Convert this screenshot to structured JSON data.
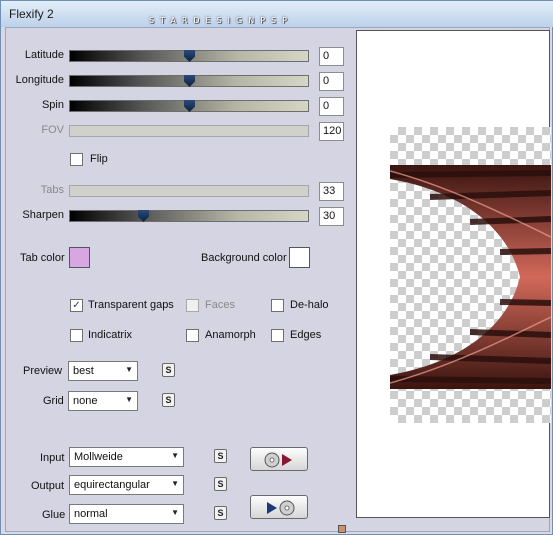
{
  "window": {
    "title": "Flexify 2",
    "brand": "STARDESIGNPSP"
  },
  "sliders": [
    {
      "label": "Latitude",
      "value": "0",
      "level": 0.5,
      "disabled": false
    },
    {
      "label": "Longitude",
      "value": "0",
      "level": 0.5,
      "disabled": false
    },
    {
      "label": "Spin",
      "value": "0",
      "level": 0.5,
      "disabled": false
    },
    {
      "label": "FOV",
      "value": "120",
      "level": null,
      "disabled": true
    },
    {
      "label": "Tabs",
      "value": "33",
      "level": null,
      "disabled": true
    },
    {
      "label": "Sharpen",
      "value": "30",
      "level": 0.3,
      "disabled": false
    }
  ],
  "flip": {
    "label": "Flip",
    "checked": false
  },
  "colors": {
    "tab_color_label": "Tab color",
    "tab_color": "#d8a6e0",
    "background_color_label": "Background color",
    "background_color": "#ffffff"
  },
  "checkboxes": {
    "transparent_gaps": {
      "label": "Transparent gaps",
      "checked": true,
      "mark": "✓"
    },
    "faces": {
      "label": "Faces",
      "checked": false,
      "disabled": true
    },
    "de_halo": {
      "label": "De-halo",
      "checked": false
    },
    "indicatrix": {
      "label": "Indicatrix",
      "checked": false
    },
    "anamorph": {
      "label": "Anamorph",
      "checked": false
    },
    "edges": {
      "label": "Edges",
      "checked": false
    }
  },
  "dropdowns": {
    "preview": {
      "label": "Preview",
      "value": "best"
    },
    "grid": {
      "label": "Grid",
      "value": "none"
    },
    "input": {
      "label": "Input",
      "value": "Mollweide"
    },
    "output": {
      "label": "Output",
      "value": "equirectangular"
    },
    "glue": {
      "label": "Glue",
      "value": "normal"
    }
  },
  "small_button_label": "S",
  "arrow_glyph": "▼",
  "icons": [
    "check-icon",
    "dropdown-arrow-icon",
    "disc-icon",
    "play-icon"
  ]
}
